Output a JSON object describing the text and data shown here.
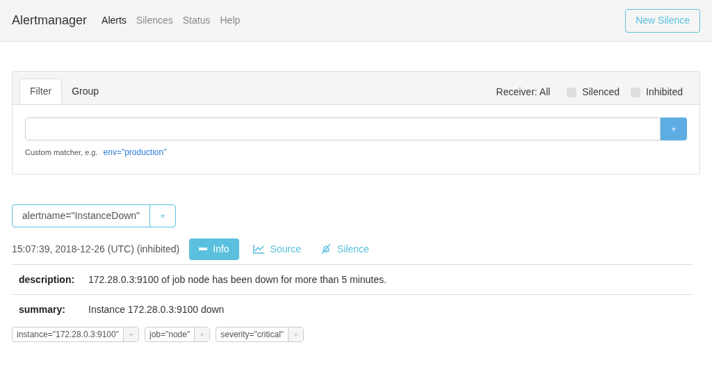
{
  "navbar": {
    "brand": "Alertmanager",
    "links": [
      {
        "label": "Alerts",
        "selected": true
      },
      {
        "label": "Silences",
        "selected": false
      },
      {
        "label": "Status",
        "selected": false
      },
      {
        "label": "Help",
        "selected": false
      }
    ],
    "action": "New Silence"
  },
  "filter": {
    "tabs": [
      {
        "label": "Filter",
        "selected": true
      },
      {
        "label": "Group",
        "selected": false
      }
    ],
    "receiver": "Receiver: All",
    "checkboxes": [
      {
        "label": "Silenced",
        "checked": false
      },
      {
        "label": "Inhibited",
        "checked": false
      }
    ],
    "add_button": "+",
    "hint": "Custom matcher, e.g.",
    "example": "env=\"production\""
  },
  "group": {
    "label": "alertname=\"InstanceDown\"",
    "add": "+"
  },
  "alert": {
    "time": "15:07:39, 2018-12-26 (UTC) (inhibited)",
    "info_button": "Info",
    "source_link": "Source",
    "silence_link": "Silence",
    "annotations": [
      {
        "key": "description:",
        "value": "172.28.0.3:9100 of job node has been down for more than 5 minutes."
      },
      {
        "key": "summary:",
        "value": "Instance 172.28.0.3:9100 down"
      }
    ],
    "labels": [
      {
        "label": "instance=\"172.28.0.3:9100\"",
        "add": "+"
      },
      {
        "label": "job=\"node\"",
        "add": "+"
      },
      {
        "label": "severity=\"critical\"",
        "add": "+"
      }
    ]
  }
}
